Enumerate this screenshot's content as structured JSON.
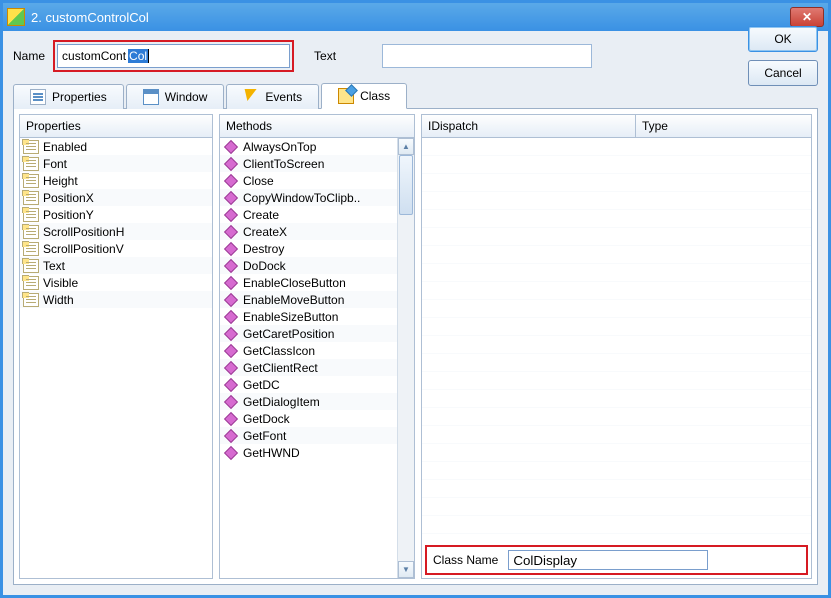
{
  "title": "2. customControlCol",
  "labels": {
    "name": "Name",
    "text": "Text",
    "className": "Class Name"
  },
  "nameField": {
    "prefix": "customCont",
    "selected": "Col"
  },
  "textField": "",
  "classNameField": "ColDisplay",
  "buttons": {
    "ok": "OK",
    "cancel": "Cancel"
  },
  "tabs": {
    "properties": "Properties",
    "window": "Window",
    "events": "Events",
    "class": "Class"
  },
  "panelHeaders": {
    "properties": "Properties",
    "methods": "Methods",
    "idispatch": "IDispatch",
    "type": "Type"
  },
  "properties": [
    "Enabled",
    "Font",
    "Height",
    "PositionX",
    "PositionY",
    "ScrollPositionH",
    "ScrollPositionV",
    "Text",
    "Visible",
    "Width"
  ],
  "methods": [
    "AlwaysOnTop",
    "ClientToScreen",
    "Close",
    "CopyWindowToClipb..",
    "Create",
    "CreateX",
    "Destroy",
    "DoDock",
    "EnableCloseButton",
    "EnableMoveButton",
    "EnableSizeButton",
    "GetCaretPosition",
    "GetClassIcon",
    "GetClientRect",
    "GetDC",
    "GetDialogItem",
    "GetDock",
    "GetFont",
    "GetHWND"
  ]
}
